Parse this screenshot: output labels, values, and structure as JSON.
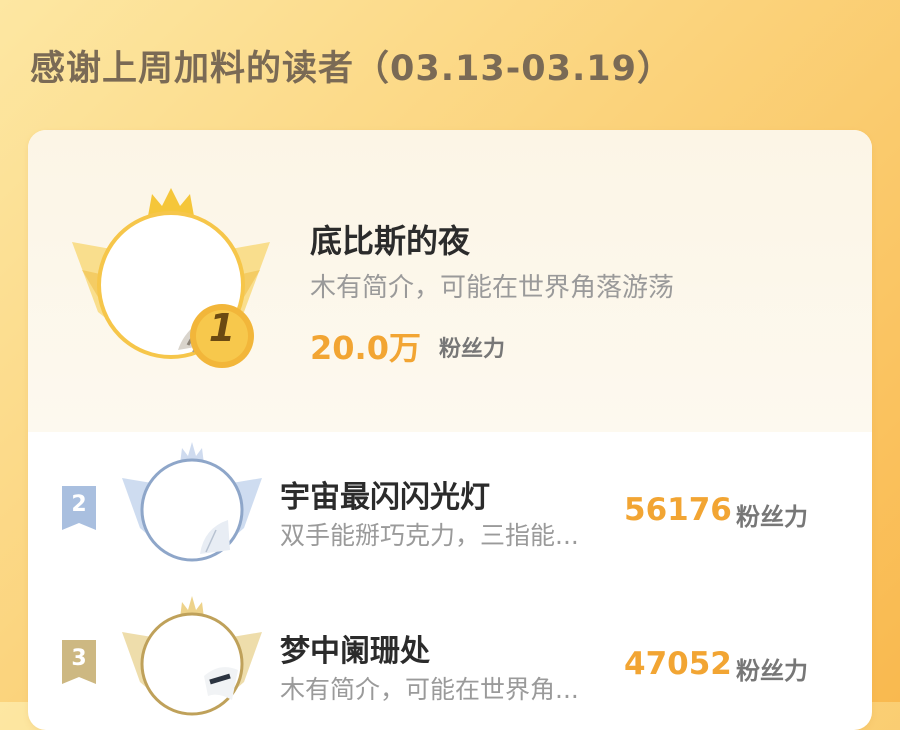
{
  "header": {
    "title": "感谢上周加料的读者（03.13-03.19）"
  },
  "fans": [
    {
      "rank": "1",
      "name": "底比斯的夜",
      "bio": "木有简介，可能在世界角落游荡",
      "score": "20.0万",
      "unit": "粉丝力"
    },
    {
      "rank": "2",
      "name": "宇宙最闪闪光灯",
      "bio": "双手能掰巧克力，三指能...",
      "score": "56176",
      "unit": "粉丝力"
    },
    {
      "rank": "3",
      "name": "梦中阑珊处",
      "bio": "木有简介，可能在世界角...",
      "score": "47052",
      "unit": "粉丝力"
    }
  ],
  "colors": {
    "gold": "#f2a533",
    "silver": "#8ea6c9",
    "bronze": "#bfa15a"
  }
}
